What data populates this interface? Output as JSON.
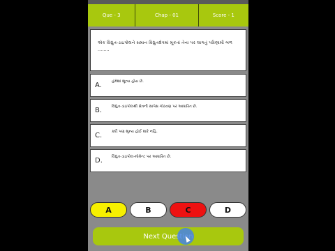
{
  "header": {
    "question_label": "Que - 3",
    "chapter_label": "Chap - 01",
    "score_label": "Score - 1"
  },
  "question": {
    "text": "એક વિદ્યુત-ડાઇપોલને સમાન વિદ્યુતક્ષેત્રમાં મૂકતાં તેના પર લાગતું પરિણામી બળ ........"
  },
  "options": [
    {
      "letter": "A.",
      "text": "હંમેશાં શૂન્ય હોય છે."
    },
    {
      "letter": "B.",
      "text": "વિદ્યુત-ડાઇપોલથી ક્ષેત્રની સાપેક્ષ ગોઠવણ પર આધારિત છે."
    },
    {
      "letter": "C.",
      "text": "કદી પણ શૂન્ય હોઈ શકે નહિ."
    },
    {
      "letter": "D.",
      "text": "વિદ્યુત-ડાઇપોલ-મોમેન્ટ પર આધારિત છે."
    }
  ],
  "answer_buttons": [
    {
      "label": "A",
      "color": "#f7f000"
    },
    {
      "label": "B",
      "color": "#ffffff"
    },
    {
      "label": "C",
      "color": "#ee1111"
    },
    {
      "label": "D",
      "color": "#ffffff"
    }
  ],
  "next_button": {
    "label": "Next Question"
  },
  "colors": {
    "accent": "#a8c80e",
    "background": "#8a8a8a"
  }
}
